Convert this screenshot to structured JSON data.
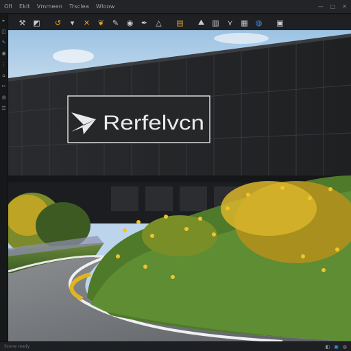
{
  "menubar": {
    "items": [
      "Ofl",
      "Ekit",
      "Vmmeen",
      "Trsclea",
      "Wloow"
    ],
    "window_controls": [
      "—",
      "□",
      "✕"
    ]
  },
  "toolbar": {
    "tools": [
      {
        "name": "wrench-icon",
        "glyph": "⚒"
      },
      {
        "name": "fill-icon",
        "glyph": "◩"
      },
      {
        "name": "rotate-icon",
        "glyph": "↺"
      },
      {
        "name": "marker-icon",
        "glyph": "▾"
      },
      {
        "name": "transform-icon",
        "glyph": "✕"
      },
      {
        "name": "plant-icon",
        "glyph": "❦"
      },
      {
        "name": "brush-icon",
        "glyph": "✎"
      },
      {
        "name": "camera-icon",
        "glyph": "◉"
      },
      {
        "name": "pen-icon",
        "glyph": "✒"
      },
      {
        "name": "triangle-icon",
        "glyph": "△"
      },
      {
        "name": "layers-icon",
        "glyph": "▤"
      },
      {
        "name": "terrain-icon",
        "glyph": "⛰"
      },
      {
        "name": "buildings-icon",
        "glyph": "▥"
      },
      {
        "name": "foliage-icon",
        "glyph": "⋎"
      },
      {
        "name": "city-icon",
        "glyph": "▦"
      },
      {
        "name": "globe-icon",
        "glyph": "◍"
      },
      {
        "name": "save-icon",
        "glyph": "▣"
      }
    ]
  },
  "left_tools": [
    "▸",
    "◫",
    "✎",
    "◉",
    "⋮",
    "⌂",
    "✂",
    "◍",
    "☰"
  ],
  "viewport": {
    "sign_text": "Rerfelvcn"
  },
  "statusbar": {
    "text": "Scene ready",
    "icons": [
      "◧",
      "▣",
      "◍"
    ]
  }
}
